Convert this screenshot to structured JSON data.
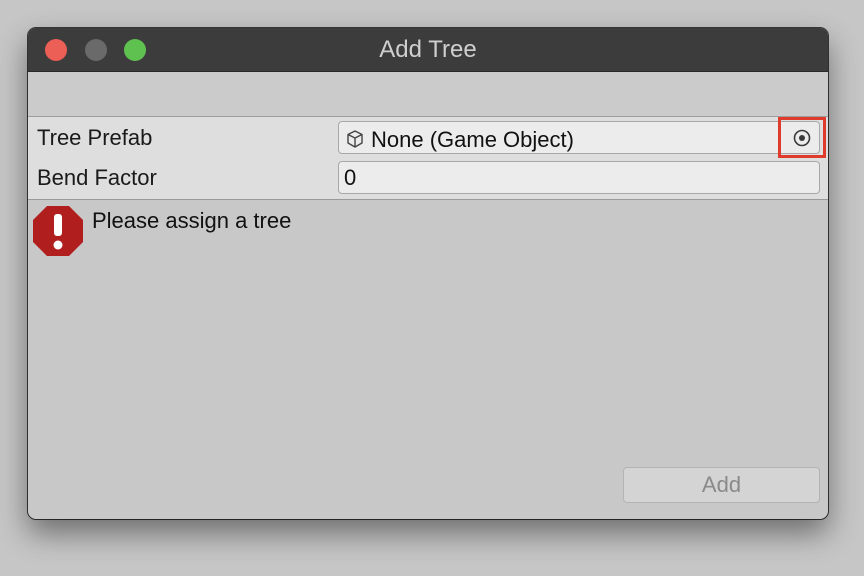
{
  "window": {
    "title": "Add Tree"
  },
  "fields": {
    "tree_prefab_label": "Tree Prefab",
    "tree_prefab_value": "None (Game Object)",
    "bend_factor_label": "Bend Factor",
    "bend_factor_value": "0"
  },
  "help": {
    "message": "Please assign a tree",
    "icon": "error-icon"
  },
  "actions": {
    "add_label": "Add"
  },
  "colors": {
    "titlebar": "#3c3c3c",
    "close": "#ec5f57",
    "zoom": "#5fc150",
    "error": "#b01e1e",
    "highlight": "#e03a2c"
  }
}
